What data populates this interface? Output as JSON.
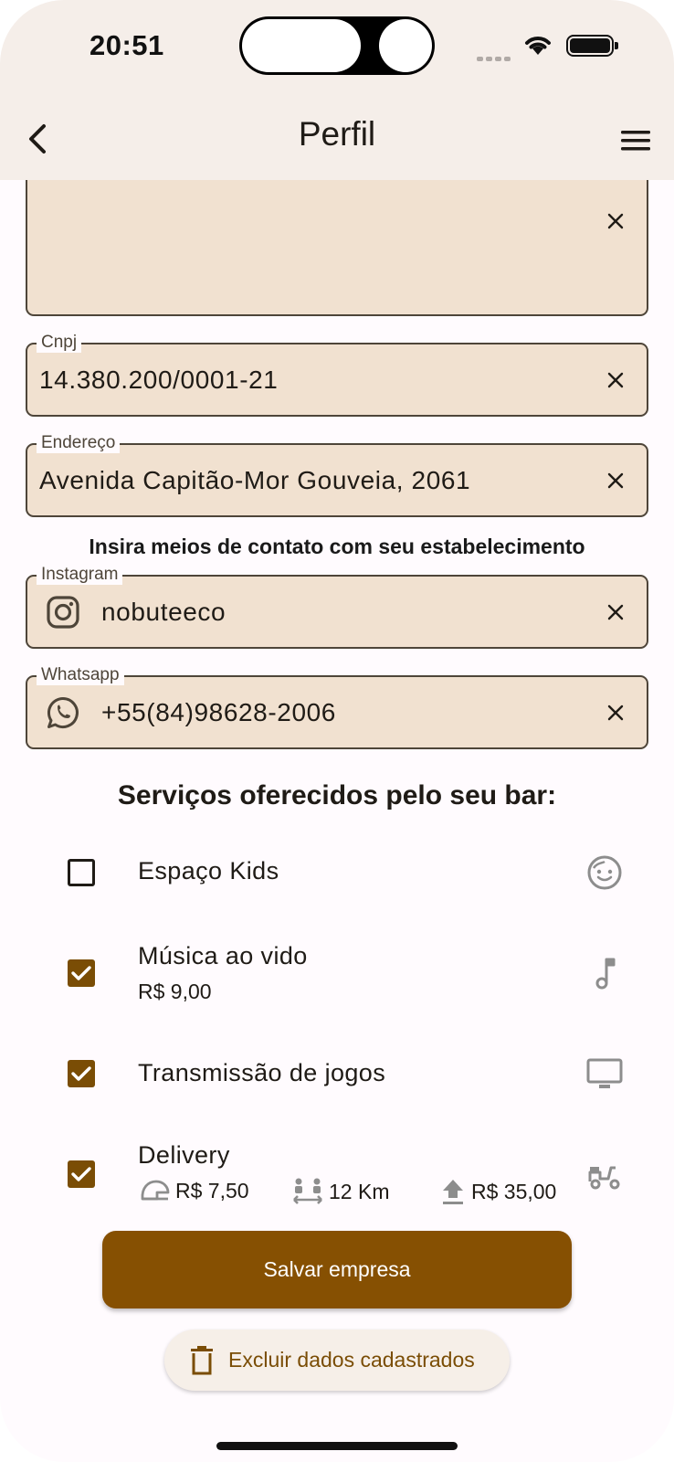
{
  "status_bar": {
    "time": "20:51"
  },
  "app_bar": {
    "title": "Perfil",
    "back_icon": "chevron-left-icon",
    "menu_icon": "hamburger-menu-icon"
  },
  "fields": {
    "description": {
      "value": ""
    },
    "cnpj": {
      "label": "Cnpj",
      "value": "14.380.200/0001-21"
    },
    "address": {
      "label": "Endereço",
      "value": "Avenida Capitão-Mor Gouveia, 2061"
    },
    "contact_heading": "Insira meios de contato com seu estabelecimento",
    "instagram": {
      "label": "Instagram",
      "value": "nobuteeco"
    },
    "whatsapp": {
      "label": "Whatsapp",
      "value": "+55(84)98628-2006"
    }
  },
  "services": {
    "heading": "Serviços oferecidos pelo seu bar:",
    "items": [
      {
        "label": "Espaço Kids",
        "checked": false,
        "icon": "child-face-icon"
      },
      {
        "label": "Música ao vido",
        "price": "R$ 9,00",
        "checked": true,
        "icon": "music-note-icon"
      },
      {
        "label": "Transmissão de jogos",
        "checked": true,
        "icon": "monitor-icon"
      },
      {
        "label": "Delivery",
        "checked": true,
        "icon": "scooter-icon",
        "details": {
          "fee": "R$ 7,50",
          "distance": "12 Km",
          "minimum": "R$ 35,00"
        }
      }
    ]
  },
  "actions": {
    "save_label": "Salvar empresa",
    "delete_label": "Excluir dados cadastrados"
  },
  "colors": {
    "primary": "#865002",
    "field_bg": "#f1e1d0",
    "app_bar_bg": "#f5eee9",
    "icon_gray": "#8d8d8d"
  }
}
